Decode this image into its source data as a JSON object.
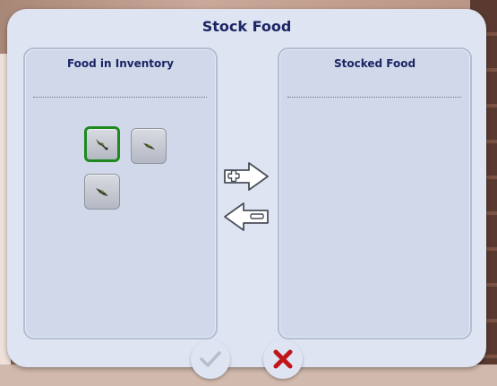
{
  "dialog": {
    "title": "Stock Food"
  },
  "inventory_panel": {
    "title": "Food in Inventory",
    "items": [
      {
        "icon": "fish-food-icon",
        "selected": true
      },
      {
        "icon": "fish-food-icon",
        "selected": false
      },
      {
        "icon": "fish-food-icon",
        "selected": false
      }
    ]
  },
  "stocked_panel": {
    "title": "Stocked Food",
    "items": []
  },
  "controls": {
    "add_icon": "arrow-right-plus-icon",
    "remove_icon": "arrow-left-minus-icon",
    "accept_icon": "checkmark-icon",
    "cancel_icon": "close-x-icon"
  },
  "colors": {
    "title": "#1b2563",
    "selected_border": "#1e8a1e",
    "cancel_red": "#c0161a"
  }
}
